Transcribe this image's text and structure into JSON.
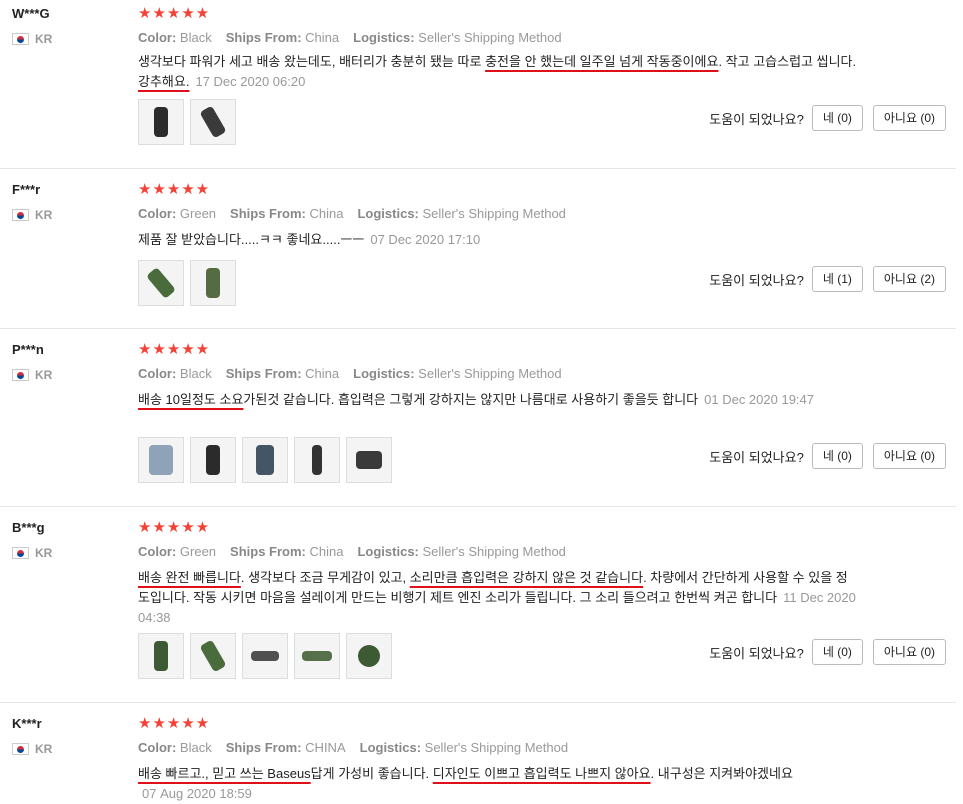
{
  "labels": {
    "color": "Color:",
    "ships_from": "Ships From:",
    "logistics": "Logistics:",
    "helpful_question": "도움이 되었나요?",
    "stars": "★★★★★"
  },
  "reviews": [
    {
      "user": "W***G",
      "country": "KR",
      "rating": 5,
      "color": "Black",
      "ships_from": "China",
      "logistics": "Seller's Shipping Method",
      "text_a": "생각보다 파워가 세고 배송 왔는데도, 배터리가 충분히 됐늗 따로 ",
      "text_b": "충전을 안 했는데 일주일 넘게 작동중이에요",
      "text_c": ". 작고 고습스럽고 씹니다. ",
      "text_d": "강추해요.",
      "date": "17 Dec 2020 06:20",
      "yes": "네 (0)",
      "no": "아니요 (0)"
    },
    {
      "user": "F***r",
      "country": "KR",
      "rating": 5,
      "color": "Green",
      "ships_from": "China",
      "logistics": "Seller's Shipping Method",
      "text_a": "제품 잘 받았습니다.....ㅋㅋ 좋네요.....ㅡㅡ",
      "date": "07 Dec 2020 17:10",
      "yes": "네 (1)",
      "no": "아니요 (2)"
    },
    {
      "user": "P***n",
      "country": "KR",
      "rating": 5,
      "color": "Black",
      "ships_from": "China",
      "logistics": "Seller's Shipping Method",
      "text_a": "배송 10일정도 소요",
      "text_b": "가된것 같습니다. 흡입력은 그렇게 강하지는 않지만 나름대로 사용하기 좋을듯 합니다",
      "date": "01 Dec 2020 19:47",
      "yes": "네 (0)",
      "no": "아니요 (0)"
    },
    {
      "user": "B***g",
      "country": "KR",
      "rating": 5,
      "color": "Green",
      "ships_from": "China",
      "logistics": "Seller's Shipping Method",
      "text_a": "배송 완전 빠릅니다",
      "text_b": ". 생각보다 조금 무게감이 있고, ",
      "text_c": "소리만큼 흡입력은 강하지 않은 것 같습니다",
      "text_d": ". 차량에서 간단하게 사용할 수 있을 정도입니다. 작동 시키면 마음을 설레이게 만드는 비행기 제트 엔진 소리가 들립니다. 그 소리 들으려고 한번씩 켜곤 합니다",
      "date": "11 Dec 2020 04:38",
      "yes": "네 (0)",
      "no": "아니요 (0)"
    },
    {
      "user": "K***r",
      "country": "KR",
      "rating": 5,
      "color": "Black",
      "ships_from": "CHINA",
      "logistics": "Seller's Shipping Method",
      "text_a": "배송 빠르고., 믿고 쓰는 Baseus",
      "text_b": "답게 가성비 좋습니다. ",
      "text_c": "디자인도 이쁘고 흡입력도 나쁘지 않아요",
      "text_d": ". 내구성은 지켜봐야겠네요",
      "date": "07 Aug 2020 18:59"
    }
  ],
  "colors": {
    "star": "#f44336",
    "underline": "#e0101a"
  }
}
